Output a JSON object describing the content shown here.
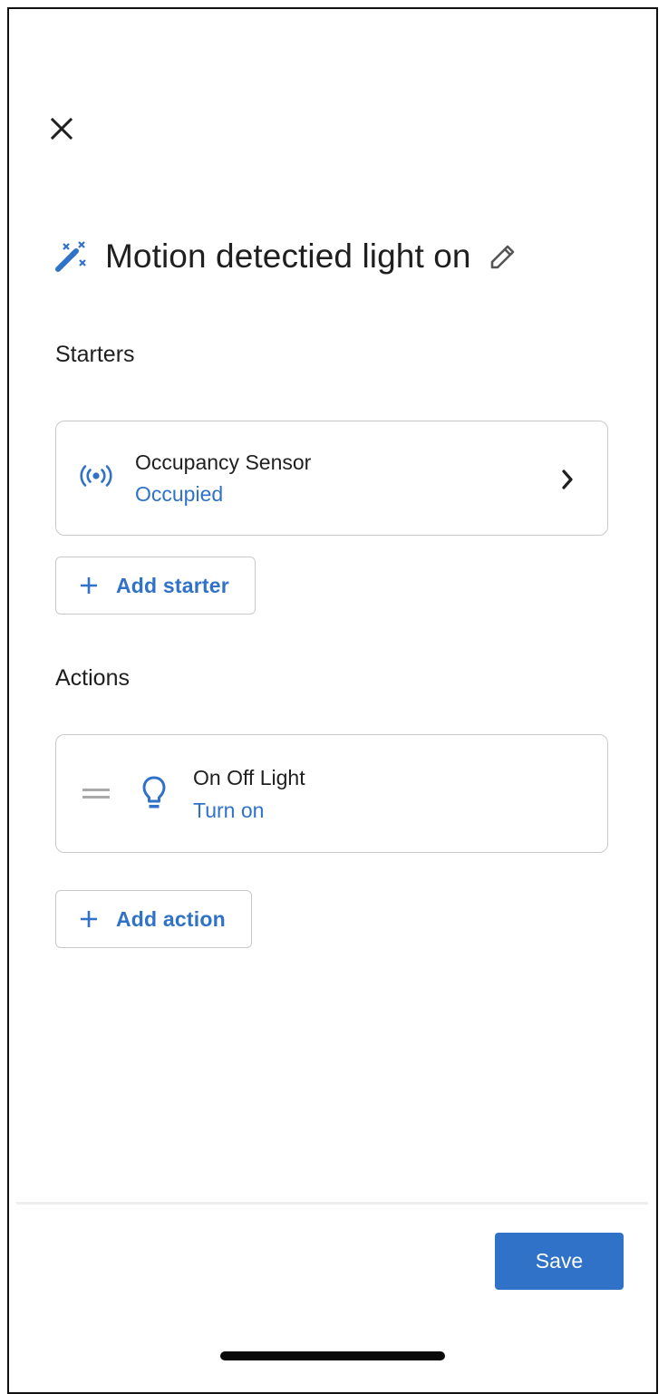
{
  "header": {
    "close_icon": "close-icon",
    "title": "Motion detectied light on",
    "title_icon": "magic-wand-icon",
    "edit_icon": "pencil-icon"
  },
  "starters": {
    "label": "Starters",
    "items": [
      {
        "name": "Occupancy Sensor",
        "state": "Occupied",
        "icon": "occupancy-sensor-icon"
      }
    ],
    "add_label": "Add starter"
  },
  "actions": {
    "label": "Actions",
    "items": [
      {
        "name": "On Off Light",
        "state": "Turn on",
        "icon": "lightbulb-icon"
      }
    ],
    "add_label": "Add action"
  },
  "footer": {
    "save_label": "Save"
  },
  "colors": {
    "accent": "#2f72c7",
    "text": "#1f1f1f",
    "border": "#c9c9c9"
  }
}
